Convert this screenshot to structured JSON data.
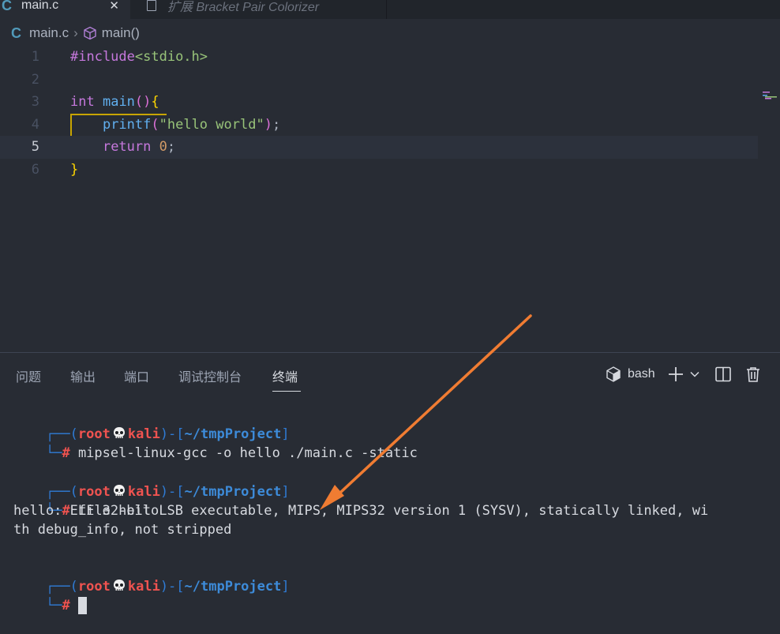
{
  "tabs": [
    {
      "label": "main.c",
      "icon": "c-language-icon",
      "active": true
    },
    {
      "label": "扩展 Bracket Pair Colorizer",
      "icon": "file-icon",
      "active": false
    }
  ],
  "breadcrumb": {
    "file": "main.c",
    "symbol": "main()"
  },
  "editor": {
    "current_line": 5,
    "lines": [
      {
        "no": "1",
        "tokens": [
          {
            "t": "#include",
            "c": "kw-pre"
          },
          {
            "t": "<stdio.h>",
            "c": "str"
          }
        ]
      },
      {
        "no": "2",
        "tokens": []
      },
      {
        "no": "3",
        "tokens": [
          {
            "t": "int",
            "c": "kw"
          },
          {
            "t": " ",
            "c": ""
          },
          {
            "t": "main",
            "c": "fn"
          },
          {
            "t": "()",
            "c": "br-p"
          },
          {
            "t": "{",
            "c": "br-y"
          }
        ]
      },
      {
        "no": "4",
        "tokens": [
          {
            "t": "    ",
            "c": ""
          },
          {
            "t": "printf",
            "c": "fn"
          },
          {
            "t": "(",
            "c": "br-p"
          },
          {
            "t": "\"hello world\"",
            "c": "str"
          },
          {
            "t": ")",
            "c": "br-p"
          },
          {
            "t": ";",
            "c": ""
          }
        ]
      },
      {
        "no": "5",
        "tokens": [
          {
            "t": "    ",
            "c": ""
          },
          {
            "t": "return",
            "c": "kw"
          },
          {
            "t": " ",
            "c": ""
          },
          {
            "t": "0",
            "c": "num"
          },
          {
            "t": ";",
            "c": ""
          }
        ]
      },
      {
        "no": "6",
        "tokens": [
          {
            "t": "}",
            "c": "br-y"
          }
        ]
      }
    ]
  },
  "panel": {
    "tabs": [
      "问题",
      "输出",
      "端口",
      "调试控制台",
      "终端"
    ],
    "active_tab": "终端",
    "shell": "bash"
  },
  "terminal": {
    "user": "root",
    "host": "kali",
    "cwd": "~/tmpProject",
    "commands": [
      {
        "cmd": "mipsel-linux-gcc -o hello ./main.c -static",
        "output": []
      },
      {
        "cmd": "file hello",
        "output": [
          "hello: ELF 32-bit LSB executable, MIPS, MIPS32 version 1 (SYSV), statically linked, wi",
          "th debug_info, not stripped"
        ]
      }
    ]
  },
  "colors": {
    "arrow": "#f07c32",
    "prompt_red": "#ef5350",
    "prompt_blue": "#2f7bd4"
  }
}
